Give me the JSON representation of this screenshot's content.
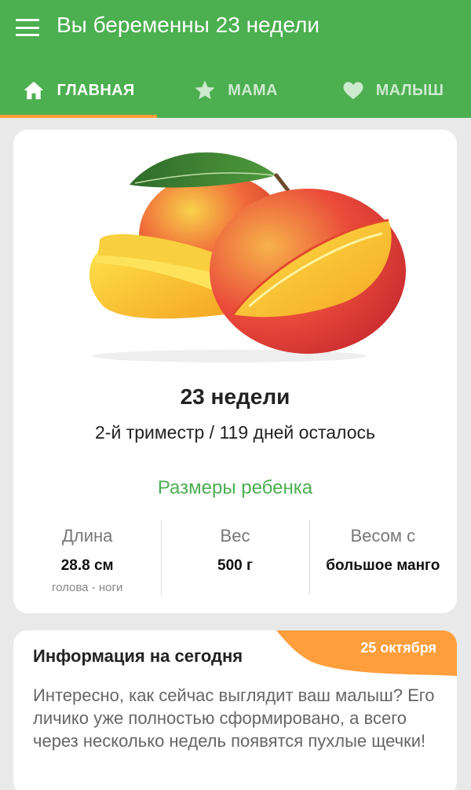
{
  "app": {
    "title": "Вы беременны 23 недели",
    "menu_icon": "hamburger-menu-icon",
    "accent": "#4caf50",
    "highlight": "#ff9e3d"
  },
  "tabs": [
    {
      "label": "ГЛАВНАЯ",
      "icon": "home-icon",
      "active": true
    },
    {
      "label": "МАМА",
      "icon": "star-icon",
      "active": false
    },
    {
      "label": "МАЛЫШ",
      "icon": "heart-icon",
      "active": false
    }
  ],
  "week_card": {
    "image": "mango-illustration",
    "week_title": "23 недели",
    "trimester": "2-й триместр / 119 дней осталось",
    "sizes_title": "Размеры ребенка",
    "stats": [
      {
        "label": "Длина",
        "value": "28.8 см",
        "sub": "голова - ноги"
      },
      {
        "label": "Вес",
        "value": "500 г",
        "sub": ""
      },
      {
        "label": "Весом с",
        "value": "большое манго",
        "sub": ""
      }
    ]
  },
  "info_card": {
    "title": "Информация на сегодня",
    "date": "25 октября",
    "text": "Интересно, как сейчас выглядит ваш малыш? Его личико уже полностью сформировано, а всего через несколько недель появятся пухлые щечки!"
  }
}
